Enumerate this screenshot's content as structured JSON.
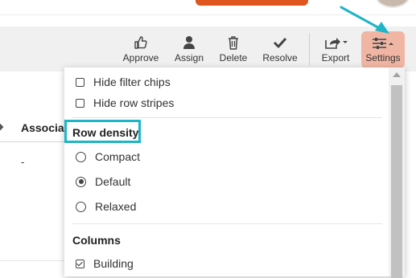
{
  "toolbar": {
    "approve_label": "Approve",
    "assign_label": "Assign",
    "delete_label": "Delete",
    "resolve_label": "Resolve",
    "export_label": "Export",
    "settings_label": "Settings"
  },
  "table": {
    "column_header": "Associat",
    "first_cell": "-"
  },
  "settings_menu": {
    "options": [
      {
        "label": "Hide filter chips",
        "checked": false
      },
      {
        "label": "Hide row stripes",
        "checked": false
      }
    ],
    "row_density": {
      "title": "Row density",
      "choices": [
        "Compact",
        "Default",
        "Relaxed"
      ],
      "selected": "Default"
    },
    "columns": {
      "title": "Columns",
      "items": [
        {
          "label": "Building",
          "checked": true
        }
      ]
    }
  },
  "colors": {
    "settings_active_bg": "#f0b6a3",
    "highlight": "#1fb5c9",
    "brand_orange": "#e0561f",
    "toolbar_bg": "#f0f0f0"
  }
}
